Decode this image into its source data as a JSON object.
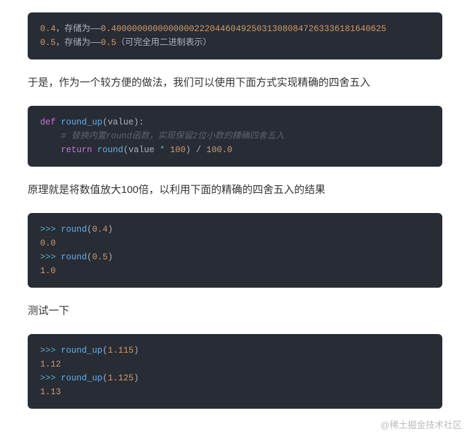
{
  "block1": {
    "l1a": "0.4",
    "l1b": "，存储为——",
    "l1c": "0.4000000000000000222044604925031308084726333618164062",
    "l1d": "5",
    "l2a": "0.5",
    "l2b": "，存储为——",
    "l2c": "0.5",
    "l2d": "（可完全用二进制表示）"
  },
  "para1": "于是，作为一个较方便的做法，我们可以使用下面方式实现精确的四舍五入",
  "block2": {
    "kw_def": "def",
    "fn": " round_up",
    "params": "(value)",
    "colon": ":",
    "comment": "    # 替换内置round函数，实现保留2位小数的精确四舍五入",
    "indent": "    ",
    "kw_ret": "return",
    "sp": " ",
    "round": "round",
    "lp": "(",
    "var": "value ",
    "op": "*",
    "sp2": " ",
    "hundred": "100",
    "rp": ")",
    "div": " / ",
    "hundredf": "100.0"
  },
  "para2": "原理就是将数值放大100倍，以利用下面的精确的四舍五入的结果",
  "block3": {
    "p1": ">>>",
    "sp": " ",
    "fn": "round",
    "lp": "(",
    "a1": "0.4",
    "rp": ")",
    "r1": "0.0",
    "a2": "0.5",
    "r2": "1.0"
  },
  "para3": "测试一下",
  "block4": {
    "p1": ">>>",
    "sp": " ",
    "fn": "round_up",
    "lp": "(",
    "a1": "1.115",
    "rp": ")",
    "r1": "1.12",
    "a2": "1.125",
    "r2": "1.13"
  },
  "watermark": "@稀土掘金技术社区"
}
